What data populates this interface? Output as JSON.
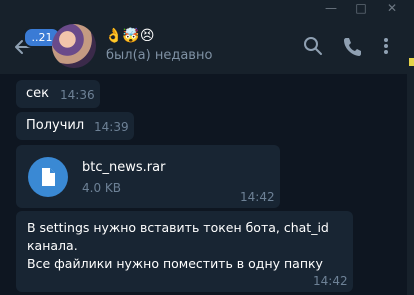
{
  "header": {
    "unread_badge": "..21",
    "chat_name": "👌🤯😣",
    "chat_status": "был(а) недавно"
  },
  "messages": [
    {
      "text": "сек",
      "time": "14:36"
    },
    {
      "text": "Получил",
      "time": "14:39"
    },
    {
      "file_name": "btc_news.rar",
      "file_size": "4.0 KB",
      "time": "14:42"
    },
    {
      "line1": "В settings нужно вставить токен бота, chat_id",
      "line2": "канала.",
      "line3": "Все файлики нужно поместить в одну папку",
      "time": "14:42"
    }
  ],
  "colors": {
    "background": "#0e1621",
    "header": "#17212b",
    "bubble": "#182533",
    "accent": "#3a89d4",
    "time": "#6d8196"
  },
  "icons": [
    "back-arrow-icon",
    "search-icon",
    "phone-icon",
    "more-vertical-icon",
    "file-icon",
    "minimize-icon",
    "maximize-icon",
    "close-icon"
  ]
}
